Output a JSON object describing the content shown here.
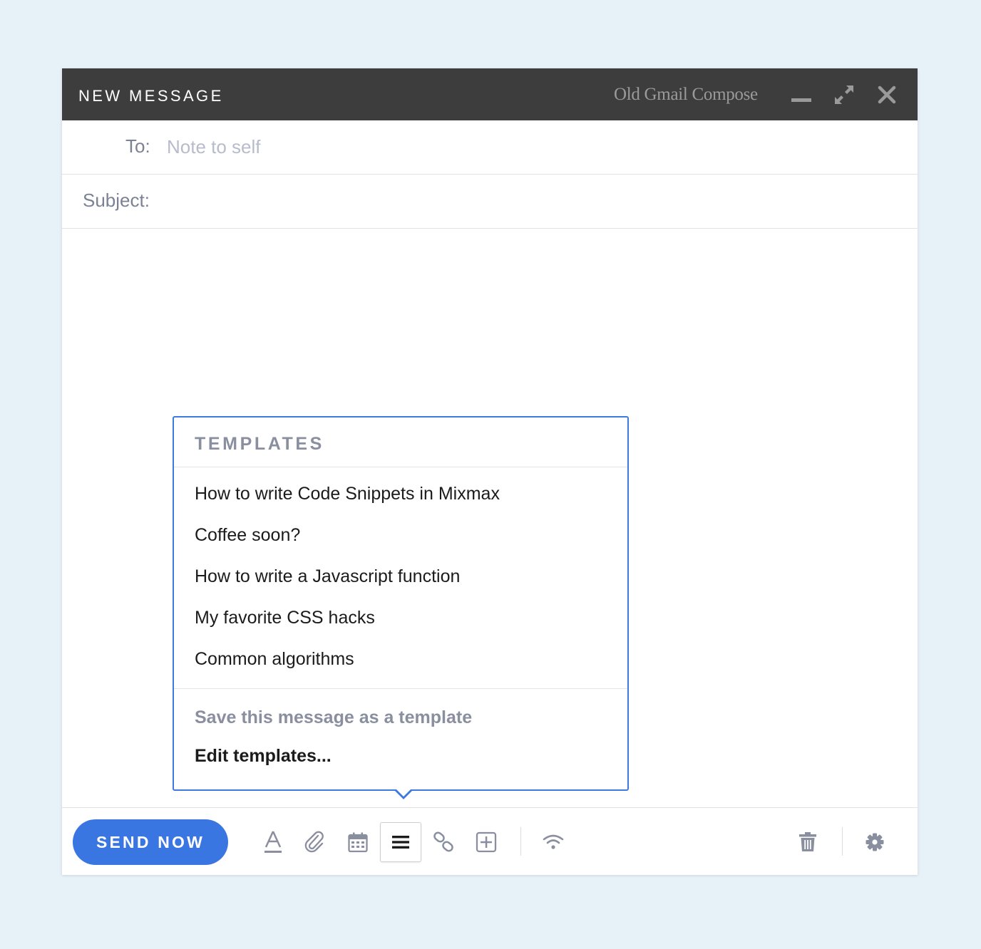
{
  "window": {
    "title": "NEW MESSAGE",
    "old_compose_link": "Old Gmail Compose"
  },
  "fields": {
    "to_label": "To:",
    "to_placeholder": "Note to self",
    "to_value": "",
    "subject_label": "Subject:",
    "subject_value": ""
  },
  "templates": {
    "heading": "TEMPLATES",
    "items": [
      "How to write Code Snippets in Mixmax",
      "Coffee soon?",
      "How to write a Javascript function",
      "My favorite CSS hacks",
      "Common algorithms"
    ],
    "save_action": "Save this message as a template",
    "edit_action": "Edit templates..."
  },
  "toolbar": {
    "send_label": "SEND NOW",
    "tools": [
      "text-format-icon",
      "attachment-icon",
      "calendar-icon",
      "templates-icon",
      "link-icon",
      "insert-icon",
      "tracking-icon",
      "trash-icon",
      "settings-icon"
    ],
    "active_tool": "templates-icon"
  },
  "colors": {
    "titlebar": "#3d3d3d",
    "accent": "#3a76e2",
    "popover_border": "#3d7ae0",
    "icon_gray": "#8a8fa0",
    "background": "#e7f1f8"
  }
}
